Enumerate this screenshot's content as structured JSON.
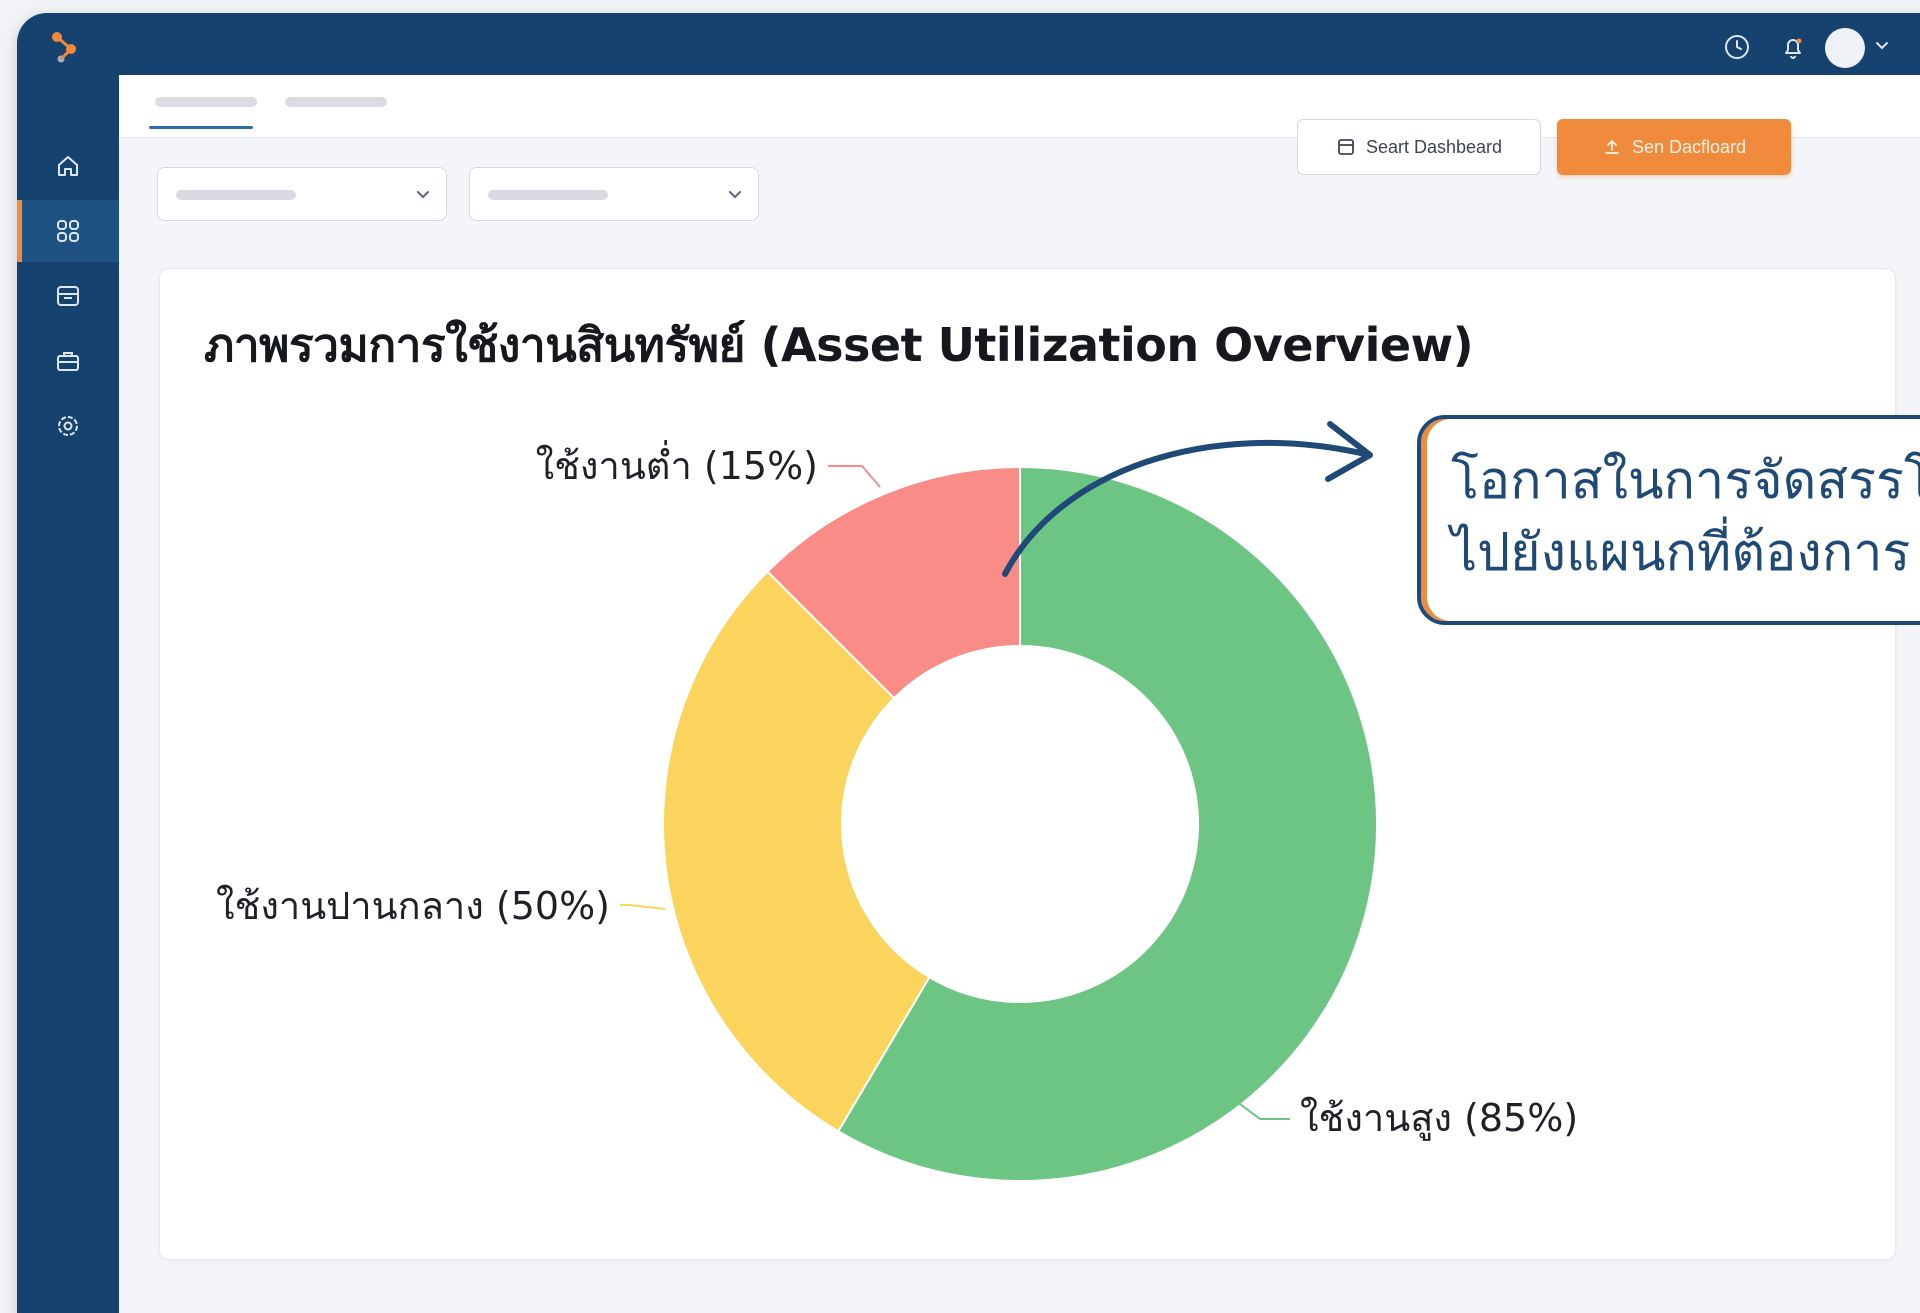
{
  "header": {
    "icons": [
      "logo-icon",
      "clock-icon",
      "bell-icon",
      "avatar",
      "chevron-down-icon"
    ]
  },
  "sidebar": {
    "items": [
      {
        "icon": "home-icon",
        "active": false
      },
      {
        "icon": "dashboard-grid-icon",
        "active": true
      },
      {
        "icon": "inventory-icon",
        "active": false
      },
      {
        "icon": "briefcase-icon",
        "active": false
      },
      {
        "icon": "settings-icon",
        "active": false
      }
    ]
  },
  "toolbar": {
    "save_label": "Seart Dashbeard",
    "share_label": "Sen Dacfloard"
  },
  "colors": {
    "navy": "#15426f",
    "accent_orange": "#f08a3c",
    "high": "#6cc583",
    "medium": "#fbd45d",
    "low": "#f98c86"
  },
  "card": {
    "title": "ภาพรวมการใช้งานสินทรัพย์ (Asset Utilization Overview)"
  },
  "chart_data": {
    "type": "pie",
    "donut": true,
    "categories": [
      "ใช้งานสูง",
      "ใช้งานปานกลาง",
      "ใช้งานต่ำ"
    ],
    "values": [
      85,
      50,
      15
    ],
    "labels": [
      "ใช้งานสูง (85%)",
      "ใช้งานปานกลาง (50%)",
      "ใช้งานต่ำ (15%)"
    ],
    "visual_share": [
      0.585,
      0.29,
      0.125
    ],
    "colors": [
      "#6cc583",
      "#fbd45d",
      "#f98c86"
    ]
  },
  "callout": {
    "line1": "โอกาสในการจัดสรรโยก",
    "line2": "ไปยังแผนกที่ต้องการ"
  }
}
